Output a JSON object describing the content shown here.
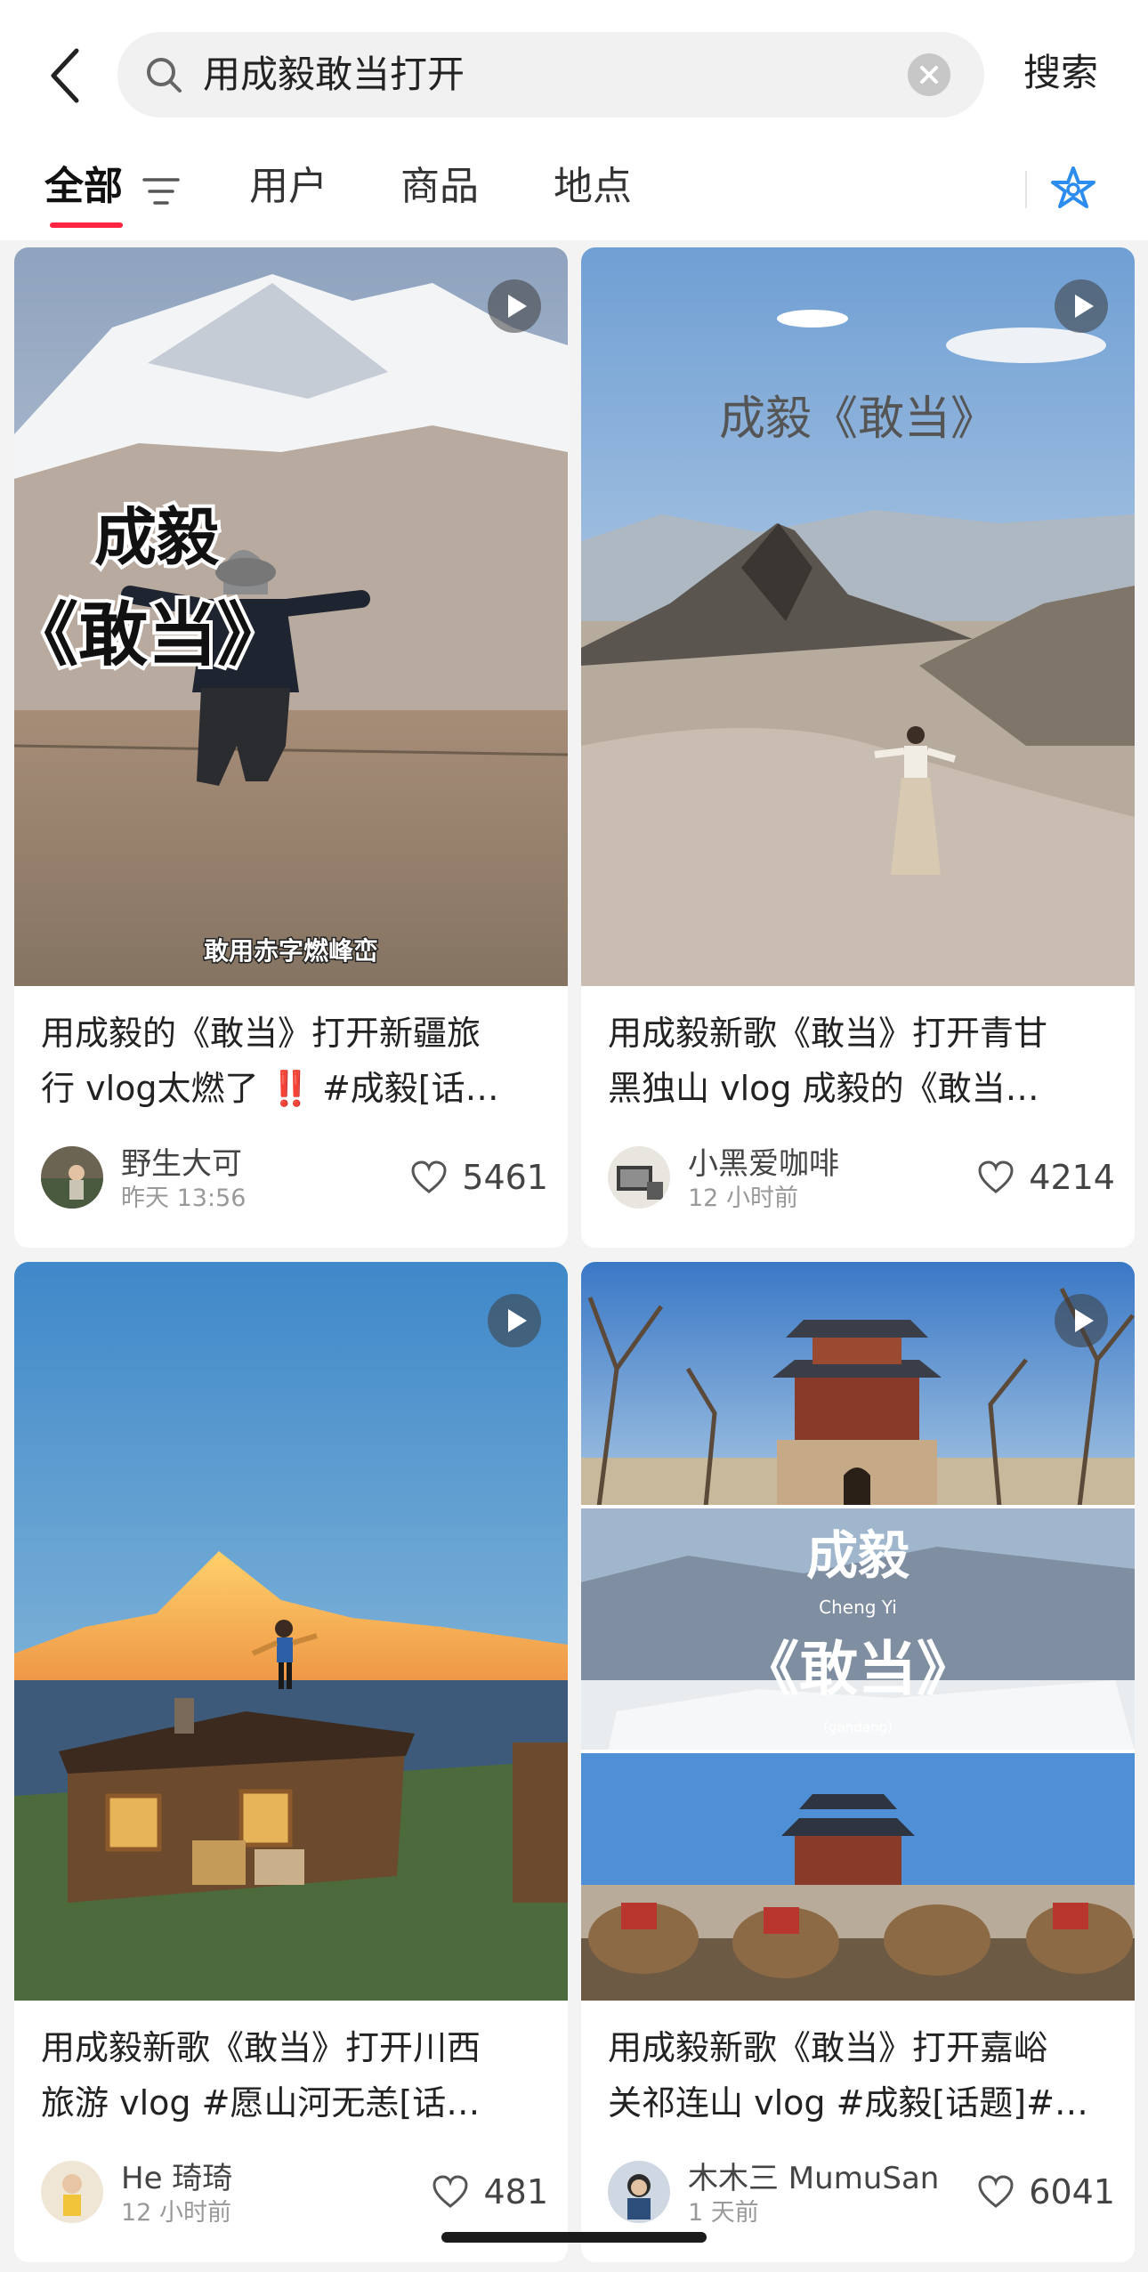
{
  "search": {
    "query": "用成毅敢当打开",
    "submit_label": "搜索"
  },
  "tabs": [
    {
      "label": "全部",
      "active": true
    },
    {
      "label": "用户",
      "active": false
    },
    {
      "label": "商品",
      "active": false
    },
    {
      "label": "地点",
      "active": false
    }
  ],
  "icons": {
    "back": "chevron-left-icon",
    "search": "search-icon",
    "clear": "clear-icon",
    "filter": "filter-icon",
    "sparkle": "sparkle-icon",
    "play": "play-icon",
    "like": "heart-icon"
  },
  "colors": {
    "accent": "#ff2442",
    "sparkle": "#2d8cf0"
  },
  "cards": [
    {
      "overlay": {
        "line1": "成毅",
        "line2": "《敢当》",
        "caption": "敢用赤字燃峰峦"
      },
      "title_line1": "用成毅的《敢当》打开新疆旅",
      "title_line2": "行 vlog太燃了 ‼️ #成毅[话…",
      "author": "野生大可",
      "time": "昨天 13:56",
      "likes": "5461"
    },
    {
      "overlay": {
        "line1": "成毅《敢当》"
      },
      "title_line1": "用成毅新歌《敢当》打开青甘",
      "title_line2": "黑独山 vlog 成毅的《敢当…",
      "author": "小黑爱咖啡",
      "time": "12 小时前",
      "likes": "4214"
    },
    {
      "title_line1": "用成毅新歌《敢当》打开川西",
      "title_line2": "旅游 vlog #愿山河无恙[话…",
      "author": "He 琦琦",
      "time": "12 小时前",
      "likes": "481"
    },
    {
      "overlay": {
        "line1": "成毅",
        "line2": "Cheng Yi",
        "line3": "《敢当》",
        "line4": "（gandang）"
      },
      "title_line1": "用成毅新歌《敢当》打开嘉峪",
      "title_line2": "关祁连山 vlog #成毅[话题]#…",
      "author": "木木三 MumuSan",
      "time": "1 天前",
      "likes": "6041"
    }
  ]
}
